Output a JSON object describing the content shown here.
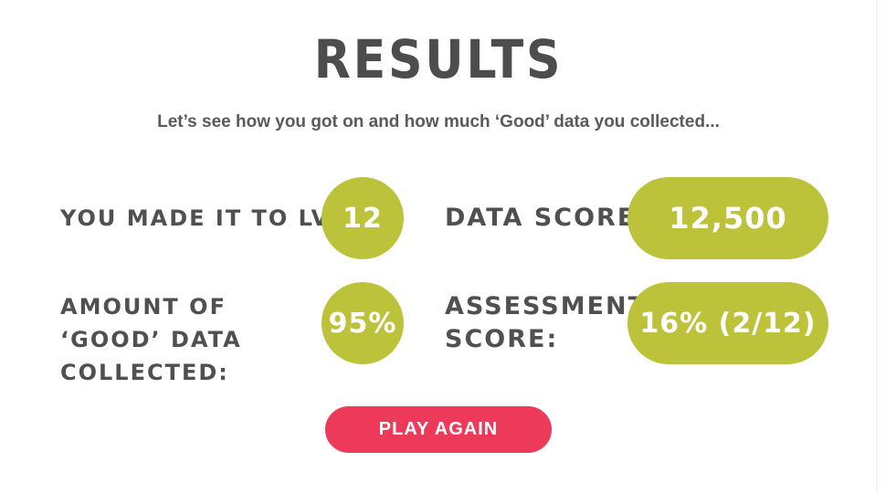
{
  "title": "RESULTS",
  "subtitle": "Let’s see how you got on and how much ‘Good’ data you collected...",
  "stats": {
    "level": {
      "label": "YOU MADE IT TO LVL:",
      "value": "12"
    },
    "data_score": {
      "label": "DATA SCORE:",
      "value": "12,500"
    },
    "good_data": {
      "label": "AMOUNT OF ‘GOOD’ DATA COLLECTED:",
      "value": "95%"
    },
    "assessment": {
      "label": "ASSESSMENT SCORE:",
      "value": "16% (2/12)"
    }
  },
  "play_again_label": "PLAY AGAIN",
  "colors": {
    "accent_green": "#bcc23a",
    "button_red": "#ed3a5b",
    "text_dark": "#4d4d4d"
  }
}
